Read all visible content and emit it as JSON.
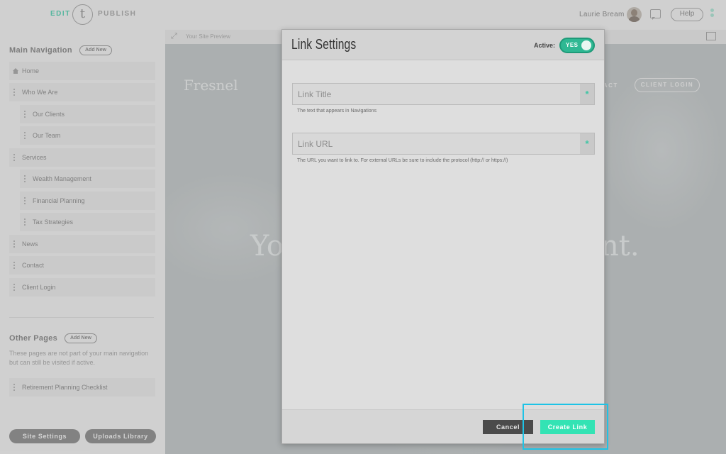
{
  "topbar": {
    "edit_label": "EDIT",
    "publish_label": "PUBLISH",
    "logo_letter": "t",
    "user_name": "Laurie Bream",
    "help_label": "Help"
  },
  "sidebar": {
    "main_nav_title": "Main Navigation",
    "add_new_label": "Add New",
    "items": [
      {
        "label": "Home"
      },
      {
        "label": "Who We Are"
      },
      {
        "label": "Our Clients"
      },
      {
        "label": "Our Team"
      },
      {
        "label": "Services"
      },
      {
        "label": "Wealth Management"
      },
      {
        "label": "Financial Planning"
      },
      {
        "label": "Tax Strategies"
      },
      {
        "label": "News"
      },
      {
        "label": "Contact"
      },
      {
        "label": "Client Login"
      }
    ],
    "other_pages_title": "Other Pages",
    "other_add_new_label": "Add New",
    "other_desc": "These pages are not part of your main navigation but can still be visited if active.",
    "other_items": [
      {
        "label": "Retirement Planning Checklist"
      }
    ],
    "site_settings_label": "Site Settings",
    "uploads_library_label": "Uploads Library"
  },
  "preview": {
    "label": "Your Site Preview",
    "site_logo": "Fresnel",
    "nav_contact": "TACT",
    "client_login": "CLIENT LOGIN",
    "hero_left": "Yo",
    "hero_right": "nt."
  },
  "modal": {
    "title": "Link Settings",
    "active_label": "Active:",
    "toggle_label": "YES",
    "link_title_placeholder": "Link Title",
    "link_title_hint": "The text that appears in Navigations",
    "link_url_placeholder": "Link URL",
    "link_url_hint": "The URL you want to link to. For external URLs be sure to include the protocol (http:// or https://)",
    "required_mark": "*",
    "cancel_label": "Cancel",
    "create_label": "Create Link"
  },
  "colors": {
    "accent": "#3fc6a5",
    "toggle": "#2fb893",
    "create_button": "#33e3b4",
    "highlight": "#1ec3e6"
  }
}
